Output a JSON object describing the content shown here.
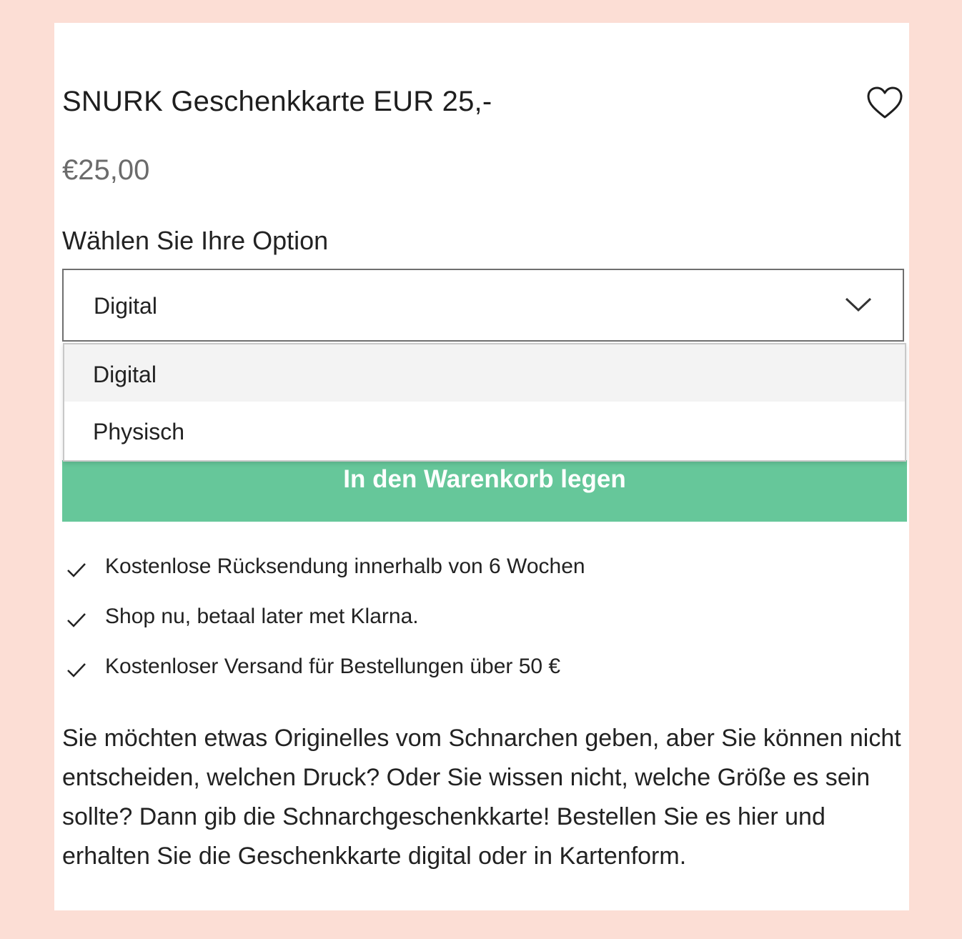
{
  "product": {
    "title": "SNURK Geschenkkarte EUR 25,-",
    "price": "€25,00",
    "wishlist_icon": "heart-icon"
  },
  "option": {
    "label": "Wählen Sie Ihre Option",
    "selected": "Digital",
    "options": [
      "Digital",
      "Physisch"
    ]
  },
  "cart": {
    "button_label": "In den Warenkorb legen",
    "button_color": "#66c79a"
  },
  "benefits": [
    "Kostenlose Rücksendung innerhalb von 6 Wochen",
    "Shop nu, betaal later met Klarna.",
    "Kostenloser Versand für Bestellungen über 50 €"
  ],
  "description": "Sie möchten etwas Originelles vom Schnarchen geben, aber Sie können nicht entscheiden, welchen Druck? Oder Sie wissen nicht, welche Größe es sein sollte? Dann gib die Schnarchgeschenkkarte! Bestellen Sie es hier und erhalten Sie die Geschenkkarte digital oder in Kartenform.",
  "colors": {
    "background": "#fcded5",
    "card": "#ffffff",
    "price": "#6b6b6b"
  }
}
